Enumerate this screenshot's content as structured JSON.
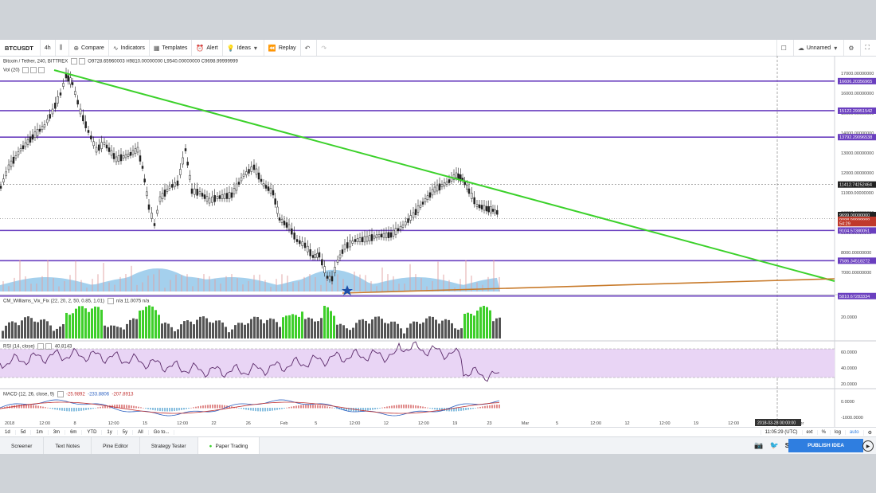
{
  "toolbar": {
    "symbol": "BTCUSDT",
    "interval": "4h",
    "compare": "Compare",
    "indicators": "Indicators",
    "templates": "Templates",
    "alert": "Alert",
    "ideas": "Ideas",
    "replay": "Replay",
    "layout_name": "Unnamed"
  },
  "legend": {
    "main": "Bitcoin / Tether, 240, BITTREX",
    "ohlc": "O9728.65960003  H9810.00000000  L9540.00000000  C9698.99999999",
    "volume": "Vol (20)",
    "williams": "CM_Williams_Vix_Fix (22, 20, 2, 50, 0.85, 1.01)",
    "williams_vals": "n/a   11.0075   n/a",
    "rsi": "RSI (14, close)",
    "rsi_val": "40.8143",
    "macd": "MACD (12, 26, close, 9)",
    "macd_vals": [
      "-25.9892",
      "-233.8806",
      "-207.8913"
    ]
  },
  "price_axis": [
    "17000.00000000",
    "16000.00000000",
    "15000.00000000",
    "14000.00000000",
    "13000.00000000",
    "12000.00000000",
    "11000.00000000",
    "10000.00000000",
    "9000.00000000",
    "8000.00000000",
    "7000.00000000"
  ],
  "price_tags": [
    {
      "label": "16606.20356965",
      "color": "#6a3fbf"
    },
    {
      "label": "15122.29951542",
      "color": "#6a3fbf"
    },
    {
      "label": "13792.29096538",
      "color": "#6a3fbf"
    },
    {
      "label": "11412.74252464",
      "color": "#222222"
    },
    {
      "label": "9699.00000000",
      "color": "#222222"
    },
    {
      "label": "9098.99999999",
      "color": "#c0392b"
    },
    {
      "label": "54:29",
      "color": "#c0392b"
    },
    {
      "label": "9104.57380051",
      "color": "#6a3fbf"
    },
    {
      "label": "7586.34518272",
      "color": "#6a3fbf"
    },
    {
      "label": "5810.67283334",
      "color": "#6a3fbf"
    }
  ],
  "williams_axis": [
    "20.0000"
  ],
  "rsi_axis": [
    "60.0000",
    "40.0000",
    "20.0000"
  ],
  "macd_axis": [
    "0.0000",
    "-1000.0000"
  ],
  "time_axis": [
    "2018",
    "12:00",
    "8",
    "12:00",
    "15",
    "12:00",
    "22",
    "26",
    "Feb",
    "5",
    "12:00",
    "12",
    "12:00",
    "19",
    "23",
    "Mar",
    "5",
    "12:00",
    "12",
    "12:00",
    "19",
    "12:00",
    "26",
    "Apr"
  ],
  "timeframes": [
    "1d",
    "5d",
    "1m",
    "3m",
    "6m",
    "YTD",
    "1y",
    "5y",
    "All",
    "Go to..."
  ],
  "status": {
    "time": "11:05:29 (UTC)",
    "ext": "ext",
    "pct": "%",
    "log": "log",
    "auto": "auto",
    "date_marker": "2018-03-28 00:00:00"
  },
  "tabs": [
    "Screener",
    "Text Notes",
    "Pine Editor",
    "Strategy Tester",
    "Paper Trading"
  ],
  "publish": "PUBLISH IDEA",
  "colors": {
    "trend": "#3bd12a",
    "hline": "#6a3fbf",
    "orange": "#c87a2a",
    "volume": "#5aaadf",
    "bull": "#3ecf2a",
    "bear": "#555555",
    "rsi_band": "#e9d5f5",
    "rsi_line": "#5b2a6a"
  }
}
